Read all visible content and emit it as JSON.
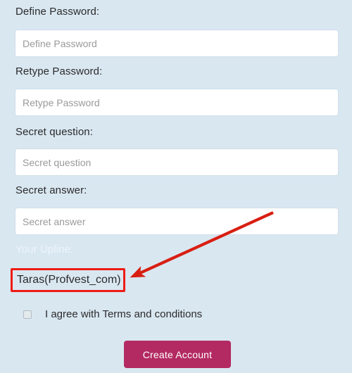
{
  "page": {
    "background_color": "#d9e7f1",
    "accent_color": "#b32a62",
    "annotation_color": "#ee1c15"
  },
  "form": {
    "fields": [
      {
        "name": "define-password",
        "label": "Define Password:",
        "placeholder": "Define Password",
        "value": ""
      },
      {
        "name": "retype-password",
        "label": "Retype Password:",
        "placeholder": "Retype Password",
        "value": ""
      },
      {
        "name": "secret-question",
        "label": "Secret question:",
        "placeholder": "Secret question",
        "value": ""
      },
      {
        "name": "secret-answer",
        "label": "Secret answer:",
        "placeholder": "Secret answer",
        "value": ""
      }
    ],
    "upline": {
      "label": "Your Upline:",
      "value": "Taras(Profvest_com)"
    },
    "terms": {
      "label": "I agree with Terms and conditions",
      "checked": false
    },
    "submit": {
      "label": "Create Account"
    }
  }
}
